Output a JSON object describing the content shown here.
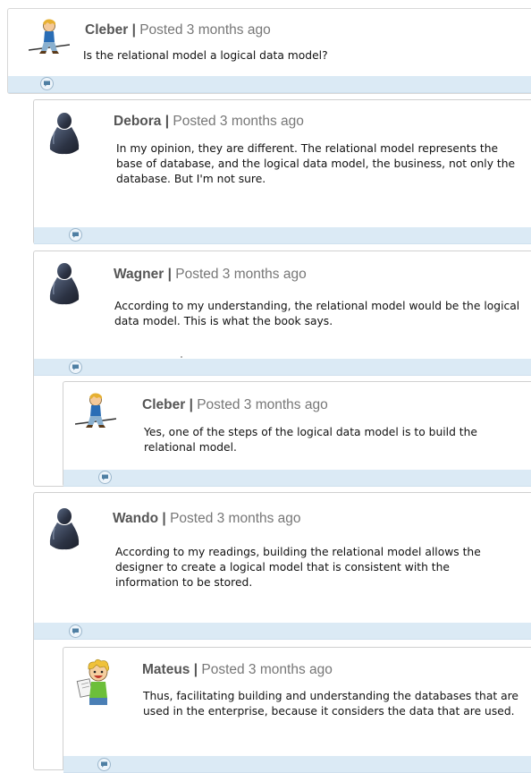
{
  "comments": [
    {
      "author": "Cleber",
      "separator": "|",
      "posted": "Posted 3 months ago",
      "text": "Is the relational model a logical data model?",
      "avatar": "tightrope-walker-avatar-icon",
      "reply_icon": "comment-bubble-icon"
    },
    {
      "author": "Debora",
      "separator": "|",
      "posted": "Posted 3 months ago",
      "text": "In my opinion, they are different. The relational model represents the base of database, and the logical data model, the business, not only the database. But I'm not sure.",
      "avatar": "silhouette-avatar-icon",
      "reply_icon": "comment-bubble-icon"
    },
    {
      "author": "Wagner",
      "separator": "|",
      "posted": "Posted 3 months ago",
      "text": "According to my understanding, the relational model would be the logical data model. This is what the book says.",
      "avatar": "silhouette-avatar-icon",
      "reply_icon": "comment-bubble-icon"
    },
    {
      "author": "Cleber",
      "separator": "|",
      "posted": "Posted 3 months ago",
      "text": "Yes, one of the steps of the logical data model is to build the relational model.",
      "avatar": "tightrope-walker-avatar-icon",
      "reply_icon": "comment-bubble-icon"
    },
    {
      "author": "Wando",
      "separator": "|",
      "posted": "Posted 3 months ago",
      "text": "According to my readings, building the relational model allows the designer to create a logical model that is consistent with the information to be stored.",
      "avatar": "silhouette-avatar-icon",
      "reply_icon": "comment-bubble-icon"
    },
    {
      "author": "Mateus",
      "separator": "|",
      "posted": "Posted 3 months ago",
      "text": "Thus, facilitating building and understanding the databases that are used in the enterprise, because it considers the data that are used.",
      "avatar": "cartoon-boy-avatar-icon",
      "reply_icon": "comment-bubble-icon"
    }
  ],
  "colors": {
    "bar": "#dbeaf5",
    "border": "#d0d0d0",
    "author": "#555555",
    "meta": "#777777"
  }
}
